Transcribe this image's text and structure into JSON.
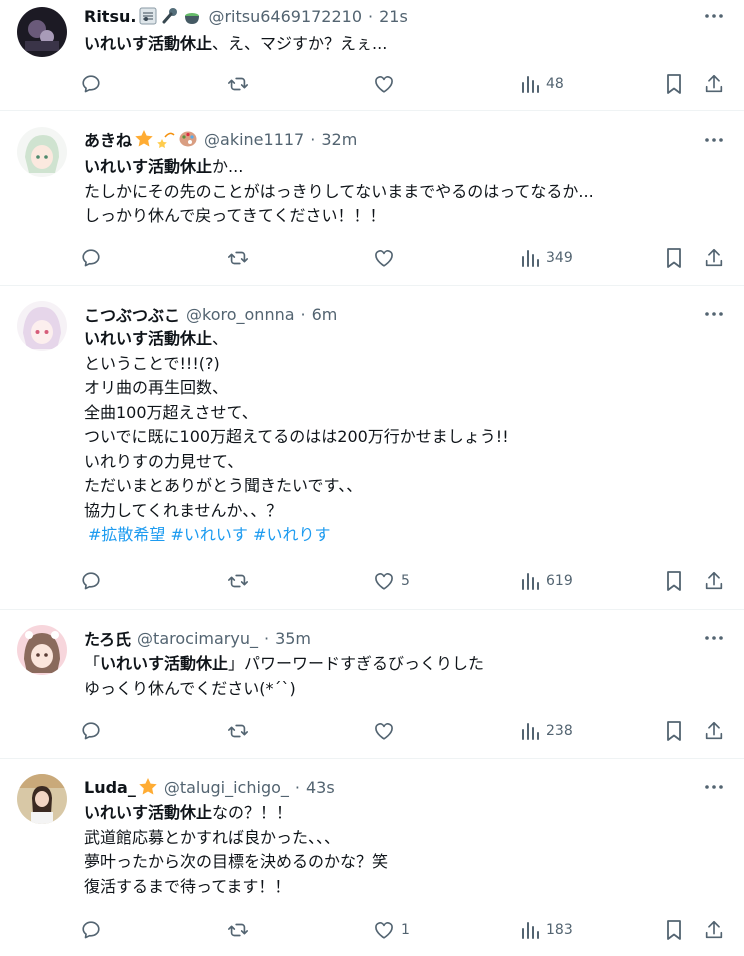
{
  "tweets": [
    {
      "name": "Ritsu.",
      "handle": "@ritsu6469172210",
      "time": "21s",
      "lines": [
        {
          "bold": "いれいす活動休止",
          "text": "、え、マジすか？えぇ..."
        }
      ],
      "replies": "",
      "retweets": "",
      "likes": "",
      "views": "48"
    },
    {
      "name": "あきね",
      "handle": "@akine1117",
      "time": "32m",
      "lines": [
        {
          "bold": "いれいす活動休止",
          "text": "か..."
        },
        {
          "bold": "",
          "text": "たしかにその先のことがはっきりしてないままでやるのはってなるか..."
        },
        {
          "bold": "",
          "text": "しっかり休んで戻ってきてください！！！"
        }
      ],
      "replies": "",
      "retweets": "",
      "likes": "",
      "views": "349"
    },
    {
      "name": "こつぶつぶこ",
      "handle": "@koro_onnna",
      "time": "6m",
      "lines": [
        {
          "bold": "いれいす活動休止",
          "text": "、"
        },
        {
          "bold": "",
          "text": "ということで!!!(?)"
        },
        {
          "bold": "",
          "text": "オリ曲の再生回数、"
        },
        {
          "bold": "",
          "text": "全曲100万超えさせて、"
        },
        {
          "bold": "",
          "text": "ついでに既に100万超えてるのはは200万行かせましょう!!"
        },
        {
          "bold": "",
          "text": "いれりすの力見せて、"
        },
        {
          "bold": "",
          "text": "ただいまとありがとう聞きたいです、、"
        },
        {
          "bold": "",
          "text": "協力してくれませんか、、？"
        }
      ],
      "hashtags": [
        "#拡散希望",
        "#いれいす",
        "#いれりす"
      ],
      "replies": "",
      "retweets": "",
      "likes": "5",
      "views": "619"
    },
    {
      "name": "たろ氏",
      "handle": "@tarocimaryu_",
      "time": "35m",
      "lines": [
        {
          "pre": "「",
          "bold": "いれいす活動休止",
          "text": "」パワーワードすぎるびっくりした"
        },
        {
          "bold": "",
          "text": "ゆっくり休んでください(*´`)"
        }
      ],
      "replies": "",
      "retweets": "",
      "likes": "",
      "views": "238"
    },
    {
      "name": "Luda_",
      "handle": "@talugi_ichigo_",
      "time": "43s",
      "lines": [
        {
          "bold": "いれいす活動休止",
          "text": "なの？！！"
        },
        {
          "bold": "",
          "text": "武道館応募とかすれば良かった、、、"
        },
        {
          "bold": "",
          "text": "夢叶ったから次の目標を決めるのかな？笑"
        },
        {
          "bold": "",
          "text": "復活するまで待ってます！！"
        }
      ],
      "replies": "",
      "retweets": "",
      "likes": "1",
      "views": "183"
    }
  ],
  "separator": "·",
  "colors": {
    "text": "#0f1419",
    "secondary": "#536471",
    "hashtag": "#1d9bf0",
    "divider": "#eff3f4"
  }
}
